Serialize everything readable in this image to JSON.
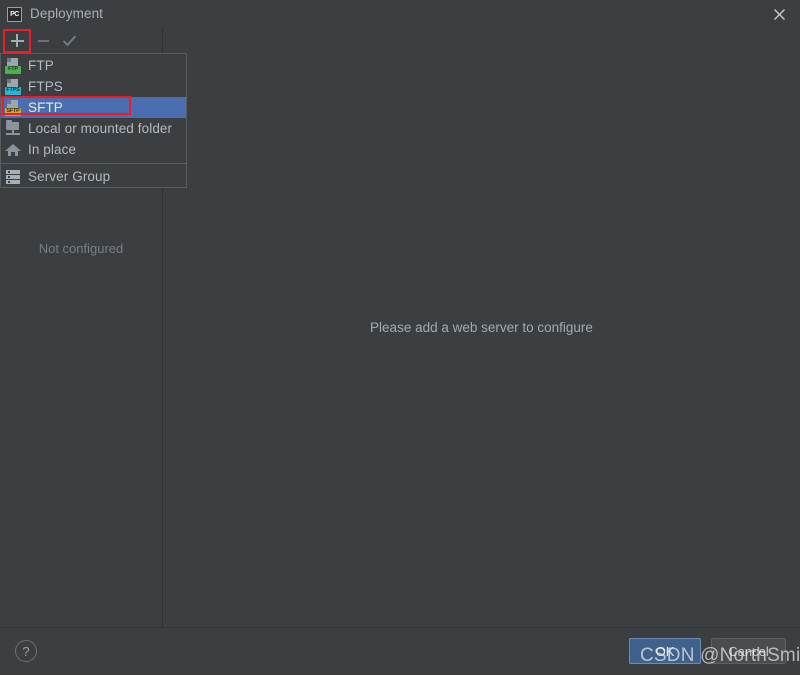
{
  "window": {
    "title": "Deployment",
    "app_icon": "pycharm-icon",
    "app_icon_text": "PC",
    "close_icon": "close-icon"
  },
  "toolbar": {
    "add_label": "+",
    "remove_label": "–",
    "confirm_label": "✓",
    "add_icon": "plus-icon",
    "remove_icon": "minus-icon",
    "confirm_icon": "check-icon",
    "add_highlight_color": "#ee1c25"
  },
  "left_panel": {
    "empty_text": "Not configured"
  },
  "main_panel": {
    "message": "Please add a web server to configure"
  },
  "dropdown": {
    "visible": true,
    "selected_index": 2,
    "highlight_color": "#4a6eb0",
    "outline_color": "#ee1c25",
    "items": [
      {
        "label": "FTP",
        "icon": "ftp-icon",
        "tag": "FTP",
        "tag_color": "#4caf50"
      },
      {
        "label": "FTPS",
        "icon": "ftps-icon",
        "tag": "FTPS",
        "tag_color": "#29b6d6"
      },
      {
        "label": "SFTP",
        "icon": "sftp-icon",
        "tag": "SFTP",
        "tag_color": "#e0a030"
      },
      {
        "label": "Local or mounted folder",
        "icon": "local-folder-icon"
      },
      {
        "label": "In place",
        "icon": "home-icon"
      },
      {
        "label": "Server Group",
        "icon": "server-group-icon"
      }
    ]
  },
  "footer": {
    "help_label": "?",
    "help_icon": "help-icon",
    "ok_label": "OK",
    "cancel_label": "Cancel"
  },
  "watermark": {
    "text": "CSDN @NorthSmile"
  }
}
